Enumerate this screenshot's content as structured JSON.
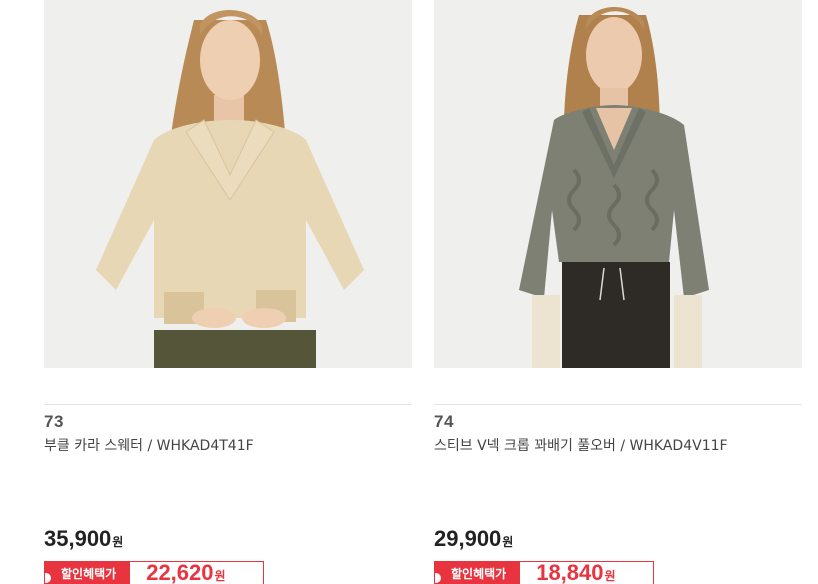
{
  "products": [
    {
      "rank": "73",
      "title": "부클 카라 스웨터 / WHKAD4T41F",
      "price": "35,900",
      "price_unit": "원",
      "benefit_label": "할인혜택가",
      "benefit_price": "22,620",
      "benefit_unit": "원",
      "image_icon": "product-photo-icon"
    },
    {
      "rank": "74",
      "title": "스티브 V넥 크롭 꽈배기 풀오버 / WHKAD4V11F",
      "price": "29,900",
      "price_unit": "원",
      "benefit_label": "할인혜택가",
      "benefit_price": "18,840",
      "benefit_unit": "원",
      "image_icon": "product-photo-icon"
    }
  ],
  "colors": {
    "accent": "#e8343f",
    "sweater_beige": "#e8d7b4",
    "sweater_grey": "#7d8073"
  }
}
